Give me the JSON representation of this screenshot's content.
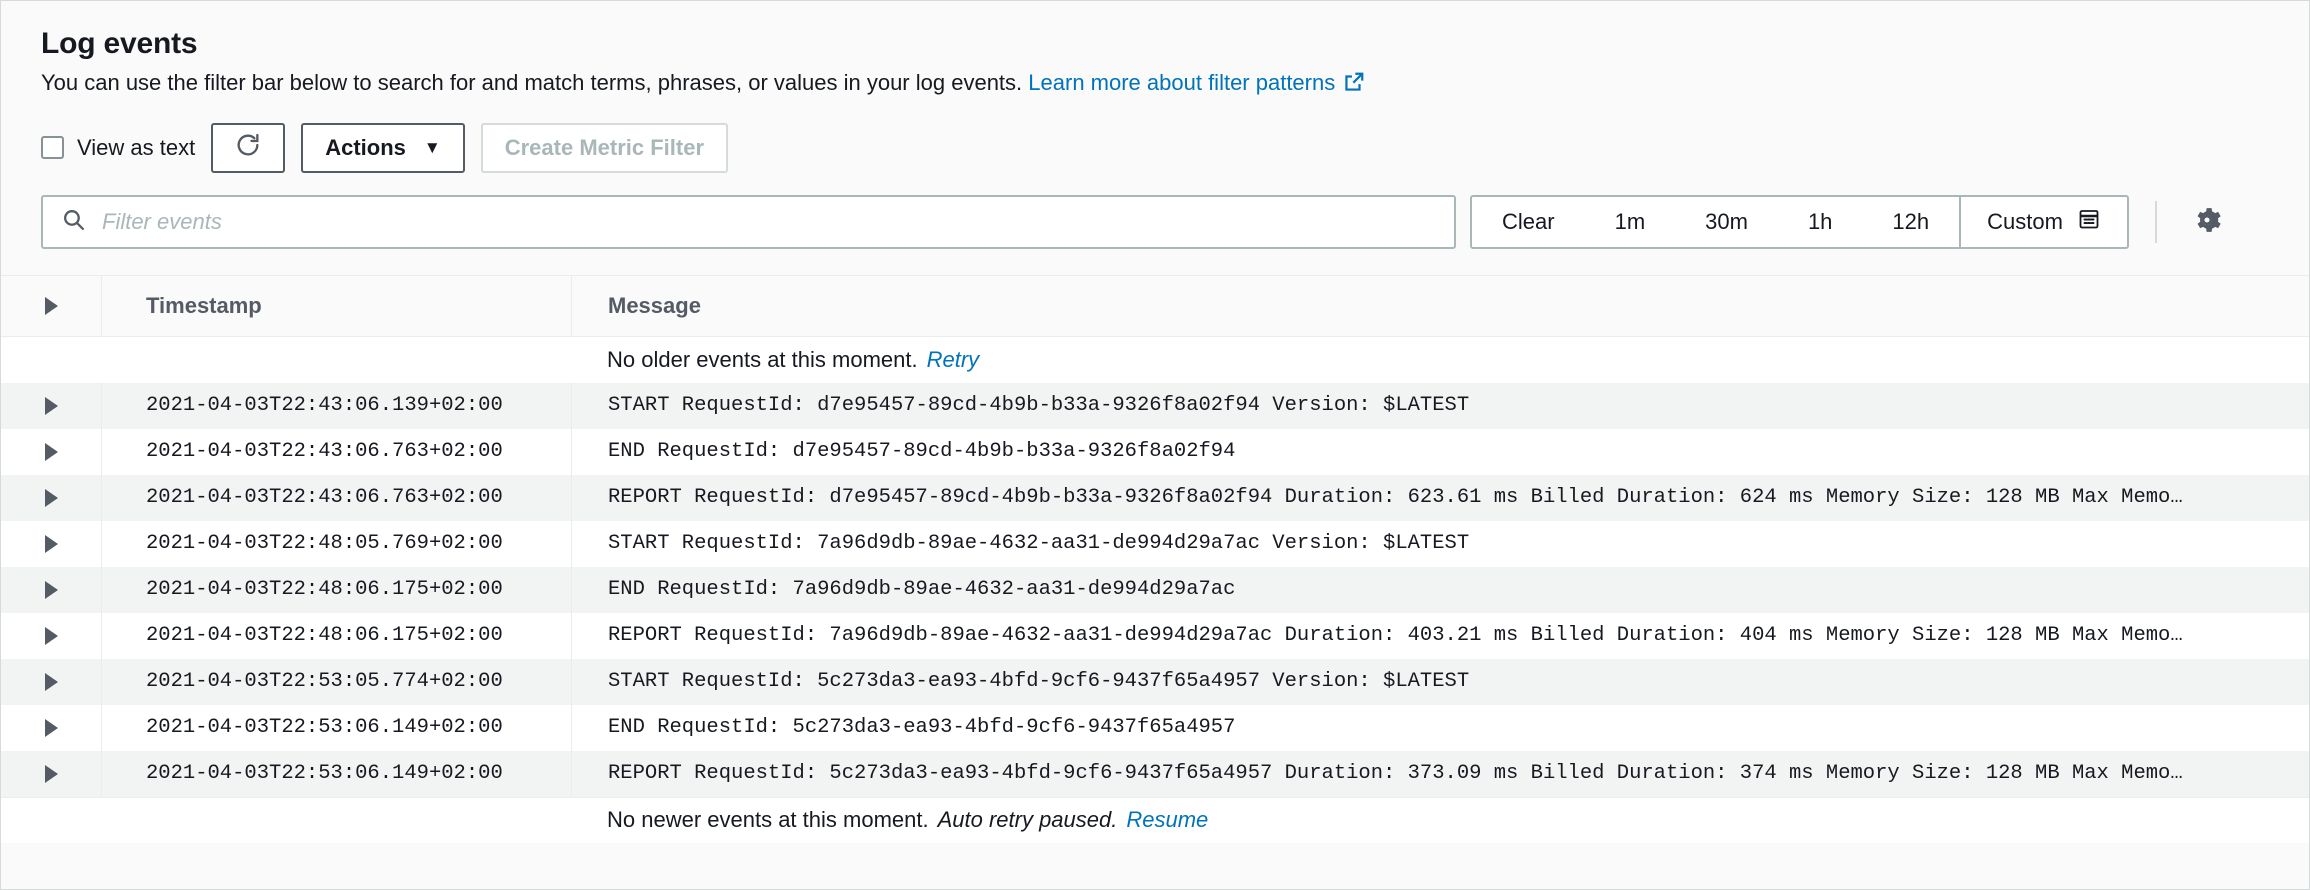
{
  "panel": {
    "title": "Log events",
    "description": "You can use the filter bar below to search for and match terms, phrases, or values in your log events.",
    "learn_more_label": "Learn more about filter patterns",
    "external_link_icon": "external-link-icon"
  },
  "toolbar": {
    "view_as_text_label": "View as text",
    "view_as_text_checked": false,
    "refresh_icon": "refresh-icon",
    "actions_label": "Actions",
    "actions_caret": "▼",
    "create_metric_filter_label": "Create Metric Filter",
    "create_metric_filter_disabled": true
  },
  "filter": {
    "search_icon": "search-icon",
    "placeholder": "Filter events",
    "value": "",
    "ranges": [
      "Clear",
      "1m",
      "30m",
      "1h",
      "12h"
    ],
    "custom_label": "Custom",
    "calendar_icon": "calendar-icon",
    "settings_icon": "gear-icon"
  },
  "table": {
    "columns": {
      "expand": "",
      "timestamp": "Timestamp",
      "message": "Message"
    },
    "top_notice": {
      "text": "No older events at this moment.",
      "link": "Retry"
    },
    "bottom_notice": {
      "text": "No newer events at this moment.",
      "status": "Auto retry paused.",
      "link": "Resume"
    },
    "rows": [
      {
        "timestamp": "2021-04-03T22:43:06.139+02:00",
        "message": "START RequestId: d7e95457-89cd-4b9b-b33a-9326f8a02f94 Version: $LATEST"
      },
      {
        "timestamp": "2021-04-03T22:43:06.763+02:00",
        "message": "END RequestId: d7e95457-89cd-4b9b-b33a-9326f8a02f94"
      },
      {
        "timestamp": "2021-04-03T22:43:06.763+02:00",
        "message": "REPORT RequestId: d7e95457-89cd-4b9b-b33a-9326f8a02f94 Duration: 623.61 ms Billed Duration: 624 ms Memory Size: 128 MB Max Memo…"
      },
      {
        "timestamp": "2021-04-03T22:48:05.769+02:00",
        "message": "START RequestId: 7a96d9db-89ae-4632-aa31-de994d29a7ac Version: $LATEST"
      },
      {
        "timestamp": "2021-04-03T22:48:06.175+02:00",
        "message": "END RequestId: 7a96d9db-89ae-4632-aa31-de994d29a7ac"
      },
      {
        "timestamp": "2021-04-03T22:48:06.175+02:00",
        "message": "REPORT RequestId: 7a96d9db-89ae-4632-aa31-de994d29a7ac Duration: 403.21 ms Billed Duration: 404 ms Memory Size: 128 MB Max Memo…"
      },
      {
        "timestamp": "2021-04-03T22:53:05.774+02:00",
        "message": "START RequestId: 5c273da3-ea93-4bfd-9cf6-9437f65a4957 Version: $LATEST"
      },
      {
        "timestamp": "2021-04-03T22:53:06.149+02:00",
        "message": "END RequestId: 5c273da3-ea93-4bfd-9cf6-9437f65a4957"
      },
      {
        "timestamp": "2021-04-03T22:53:06.149+02:00",
        "message": "REPORT RequestId: 5c273da3-ea93-4bfd-9cf6-9437f65a4957 Duration: 373.09 ms Billed Duration: 374 ms Memory Size: 128 MB Max Memo…"
      }
    ]
  },
  "colors": {
    "link": "#0073bb",
    "text": "#16191f",
    "muted": "#545b64",
    "disabled": "#aab7b8",
    "stripe": "#f2f3f3",
    "panel_bg": "#fafafa"
  }
}
